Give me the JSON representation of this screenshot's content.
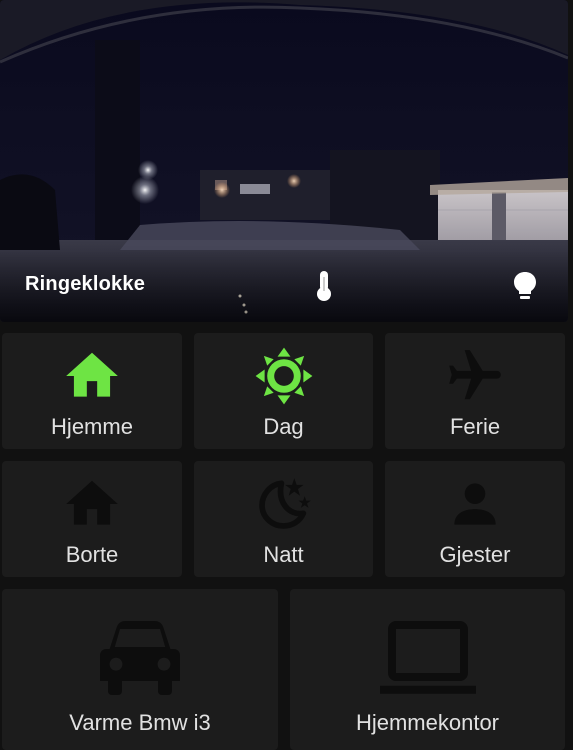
{
  "camera": {
    "title": "Ringeklokke",
    "icons": [
      "thermometer-icon",
      "lightbulb-icon"
    ]
  },
  "colors": {
    "active": "#6ee444",
    "inactive": "#0d0d0d",
    "tile_bg": "#1c1c1c",
    "label": "#e1e1e1"
  },
  "tiles": [
    {
      "label": "Hjemme",
      "icon": "home-icon",
      "active": true
    },
    {
      "label": "Dag",
      "icon": "sun-icon",
      "active": true
    },
    {
      "label": "Ferie",
      "icon": "airplane-icon",
      "active": false
    },
    {
      "label": "Borte",
      "icon": "home-icon",
      "active": false
    },
    {
      "label": "Natt",
      "icon": "moon-stars-icon",
      "active": false
    },
    {
      "label": "Gjester",
      "icon": "person-icon",
      "active": false
    },
    {
      "label": "Varme Bmw i3",
      "icon": "car-icon",
      "active": false
    },
    {
      "label": "Hjemmekontor",
      "icon": "laptop-icon",
      "active": false
    }
  ]
}
